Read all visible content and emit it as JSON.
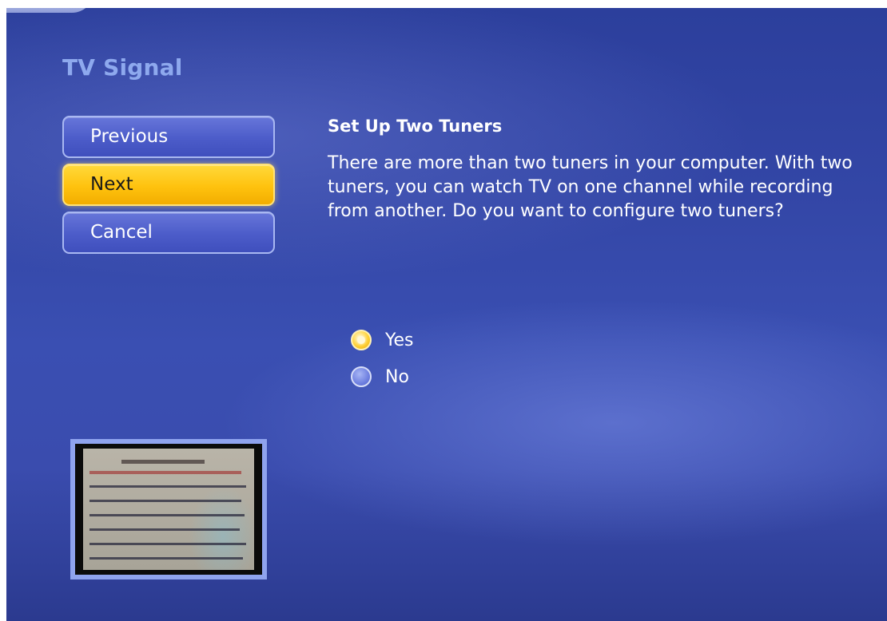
{
  "page": {
    "title": "TV Signal"
  },
  "nav": {
    "buttons": [
      {
        "label": "Previous",
        "focused": false
      },
      {
        "label": "Next",
        "focused": true
      },
      {
        "label": "Cancel",
        "focused": false
      }
    ]
  },
  "content": {
    "heading": "Set Up Two Tuners",
    "body": "There are more than two tuners in your computer. With two tuners, you can watch TV on one channel while recording from another. Do you want to configure two tuners?"
  },
  "options": [
    {
      "label": "Yes",
      "selected": true
    },
    {
      "label": "No",
      "selected": false
    }
  ],
  "preview": {
    "icon": "tv-preview-thumbnail"
  },
  "colors": {
    "background": "#3346a6",
    "title": "#8ea9ee",
    "focus": "#ffc20e",
    "button": "#4c5cc9"
  }
}
